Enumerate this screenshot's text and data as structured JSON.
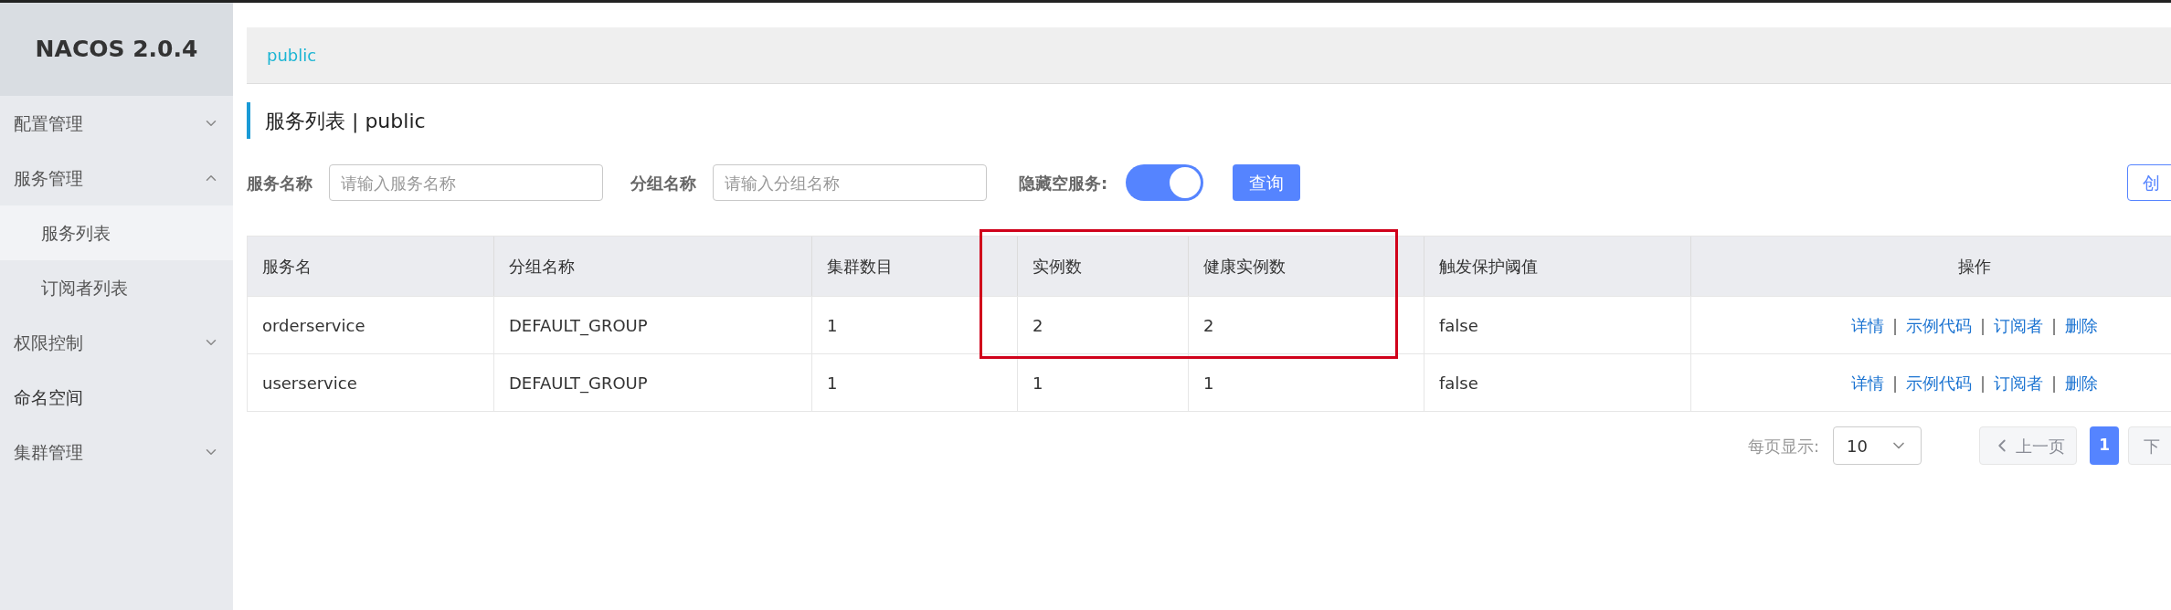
{
  "sidebar": {
    "title": "NACOS 2.0.4",
    "items": [
      {
        "kind": "group",
        "label": "配置管理",
        "expanded": false
      },
      {
        "kind": "group",
        "label": "服务管理",
        "expanded": true,
        "children": [
          {
            "label": "服务列表",
            "selected": true
          },
          {
            "label": "订阅者列表",
            "selected": false
          }
        ]
      },
      {
        "kind": "group",
        "label": "权限控制",
        "expanded": false
      },
      {
        "kind": "link",
        "label": "命名空间"
      },
      {
        "kind": "group",
        "label": "集群管理",
        "expanded": false
      }
    ]
  },
  "breadcrumb": "public",
  "page_title": "服务列表 | public",
  "filters": {
    "service_name": {
      "label": "服务名称",
      "placeholder": "请输入服务名称"
    },
    "group_name": {
      "label": "分组名称",
      "placeholder": "请输入分组名称"
    },
    "hide_empty": {
      "label": "隐藏空服务:",
      "on": true
    },
    "query_button": "查询",
    "create_button": "创"
  },
  "table": {
    "columns": [
      "服务名",
      "分组名称",
      "集群数目",
      "实例数",
      "健康实例数",
      "触发保护阈值",
      "操作"
    ],
    "rows": [
      {
        "cells": [
          "orderservice",
          "DEFAULT_GROUP",
          "1",
          "2",
          "2",
          "false"
        ],
        "actions": [
          {
            "kind": "link",
            "label": "详情"
          },
          {
            "kind": "separator",
            "label": "|"
          },
          {
            "kind": "link",
            "label": "示例代码"
          },
          {
            "kind": "separator",
            "label": "|"
          },
          {
            "kind": "link",
            "label": "订阅者"
          },
          {
            "kind": "separator",
            "label": "|"
          },
          {
            "kind": "link",
            "label": "删除"
          }
        ]
      },
      {
        "cells": [
          "userservice",
          "DEFAULT_GROUP",
          "1",
          "1",
          "1",
          "false"
        ],
        "actions": [
          {
            "kind": "link",
            "label": "详情"
          },
          {
            "kind": "separator",
            "label": "|"
          },
          {
            "kind": "link",
            "label": "示例代码"
          },
          {
            "kind": "separator",
            "label": "|"
          },
          {
            "kind": "link",
            "label": "订阅者"
          },
          {
            "kind": "separator",
            "label": "|"
          },
          {
            "kind": "link",
            "label": "删除"
          }
        ]
      }
    ]
  },
  "pagination": {
    "page_size_label": "每页显示:",
    "page_size": "10",
    "prev": {
      "label": "上一页",
      "disabled": true
    },
    "pages": [
      {
        "label": "1",
        "selected": true
      }
    ],
    "next": {
      "label": "下",
      "disabled": true
    }
  }
}
